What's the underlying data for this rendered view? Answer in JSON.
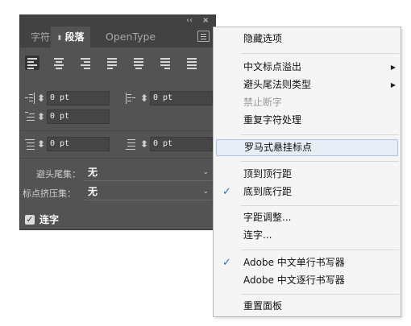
{
  "panel": {
    "topbar": {
      "collapse_glyph": "‹‹",
      "close_glyph": "×"
    },
    "tabs": [
      {
        "label": "字符",
        "active": false
      },
      {
        "label": "段落",
        "active": true,
        "arrows": "⬍"
      },
      {
        "label": "OpenType",
        "active": false
      }
    ],
    "alignment_buttons": [
      {
        "icon": "align-left-icon",
        "active": true
      },
      {
        "icon": "align-center-icon",
        "active": false
      },
      {
        "icon": "align-right-icon",
        "active": false
      },
      {
        "icon": "justify-last-left-icon",
        "active": false
      },
      {
        "icon": "justify-last-center-icon",
        "active": false
      },
      {
        "icon": "justify-last-right-icon",
        "active": false
      },
      {
        "icon": "justify-all-icon",
        "active": false
      }
    ],
    "fields": {
      "left_indent": "0 pt",
      "right_indent": "0 pt",
      "first_line_indent": "0 pt",
      "space_before": "0 pt",
      "space_after": "0 pt"
    },
    "spinner_glyph": "⬍",
    "kinsoku": {
      "label": "避头尾集：",
      "value": "无"
    },
    "mojikumi": {
      "label": "标点挤压集：",
      "value": "无"
    },
    "dropdown_arrow": "⌄",
    "hyphenation": {
      "label": "连字",
      "checked": true,
      "check_glyph": "✓"
    }
  },
  "menu": {
    "items": [
      {
        "label": "隐藏选项"
      },
      {
        "label": "中文标点溢出",
        "submenu": "▶"
      },
      {
        "label": "避头尾法则类型",
        "submenu": "▶"
      },
      {
        "label": "禁止断字",
        "disabled": true
      },
      {
        "label": "重复字符处理"
      },
      {
        "label": "罗马式悬挂标点",
        "highlighted": true
      },
      {
        "label": "顶到顶行距"
      },
      {
        "label": "底到底行距",
        "checked": true
      },
      {
        "label": "字距调整..."
      },
      {
        "label": "连字..."
      },
      {
        "label": "Adobe 中文单行书写器",
        "checked": true
      },
      {
        "label": "Adobe 中文逐行书写器"
      },
      {
        "label": "重置面板"
      }
    ],
    "check_glyph": "✓"
  }
}
